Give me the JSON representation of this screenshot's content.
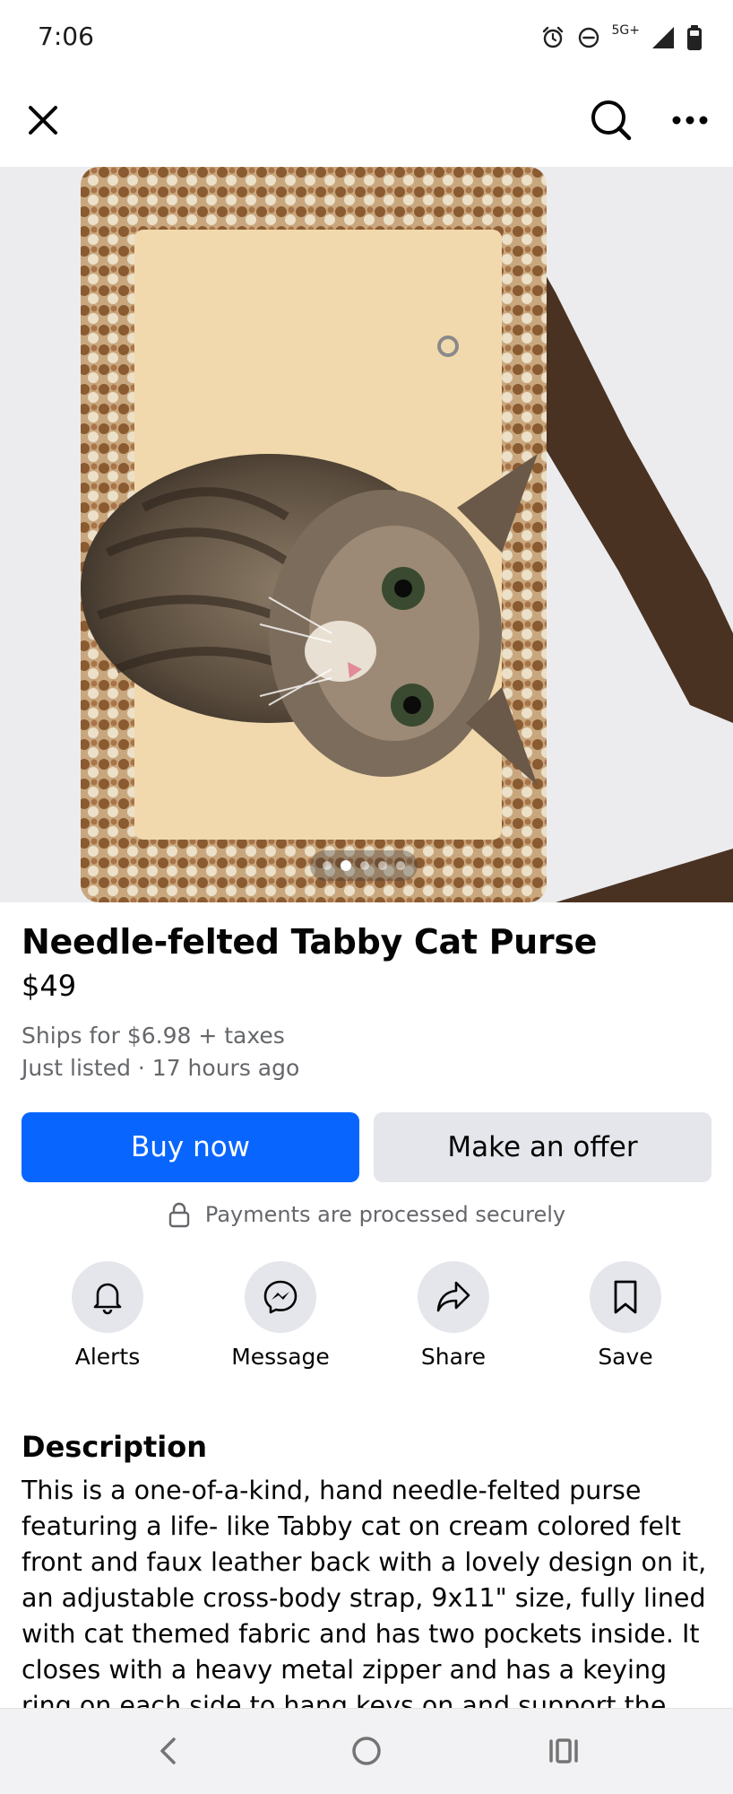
{
  "status_bar": {
    "time": "7:06",
    "network": "5G+",
    "icons": [
      "alarm-icon",
      "do-not-disturb-icon",
      "signal-icon",
      "battery-icon"
    ]
  },
  "top_nav": {
    "icons": [
      "close-icon",
      "search-icon",
      "more-icon"
    ]
  },
  "carousel": {
    "photo_count": 5,
    "active_index": 1
  },
  "listing": {
    "title": "Needle-felted Tabby Cat Purse",
    "price": "$49",
    "shipping": "Ships for $6.98 + taxes",
    "listed": "Just listed · 17 hours ago"
  },
  "buttons": {
    "buy_now": "Buy now",
    "make_offer": "Make an offer"
  },
  "secure_note": "Payments are processed securely",
  "actions": [
    {
      "label": "Alerts",
      "icon": "bell-icon"
    },
    {
      "label": "Message",
      "icon": "messenger-icon"
    },
    {
      "label": "Share",
      "icon": "share-icon"
    },
    {
      "label": "Save",
      "icon": "bookmark-icon"
    }
  ],
  "description": {
    "heading": "Description",
    "text": "This is a one-of-a-kind, hand needle-felted purse featuring a life- like Tabby cat on cream colored felt front and faux leather back with a lovely design on it, an adjustable cross-body strap, 9x11\" size, fully lined with cat themed fabric and has two pockets inside. It closes with a heavy metal zipper and has a keying ring on each side to hang keys on and support the shoulder strap. A"
  },
  "colors": {
    "primary_blue": "#0866ff",
    "secondary_gray": "#e4e6eb",
    "muted_text": "#65676b"
  },
  "system_nav": {
    "icons": [
      "back-icon",
      "home-icon",
      "recents-icon"
    ]
  }
}
